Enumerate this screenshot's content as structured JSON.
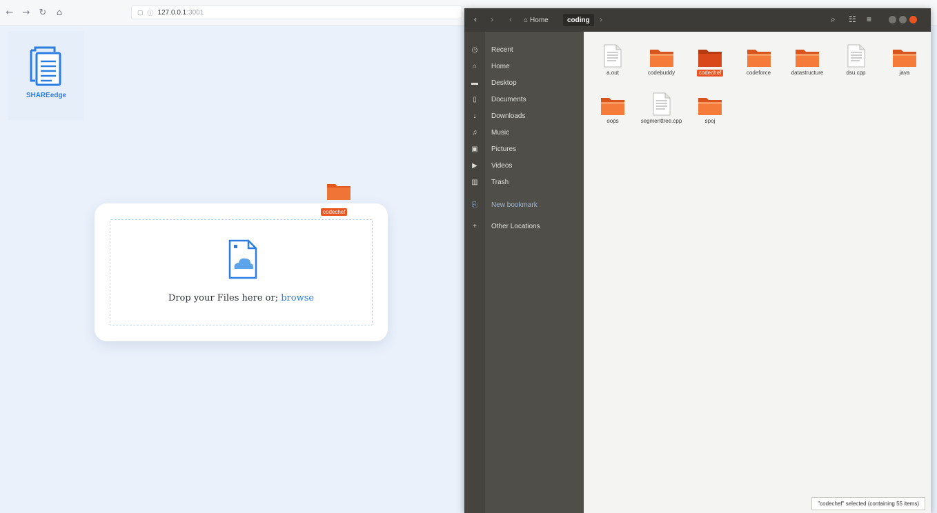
{
  "browser": {
    "url_host": "127.0.0.1",
    "url_port": ":3001",
    "back_glyph": "←",
    "forward_glyph": "→",
    "reload_glyph": "↻",
    "home_glyph": "⌂"
  },
  "app": {
    "logo_text": "SHAREedge",
    "drop_text_prefix": "Drop your Files here or; ",
    "browse_label": "browse",
    "drag_label": "codechef"
  },
  "file_manager": {
    "breadcrumb": [
      "Home",
      "coding"
    ],
    "sidebar": [
      {
        "label": "Recent",
        "icon": "clock-icon",
        "glyph": "◷"
      },
      {
        "label": "Home",
        "icon": "home-icon",
        "glyph": "⌂"
      },
      {
        "label": "Desktop",
        "icon": "desktop-icon",
        "glyph": "▬"
      },
      {
        "label": "Documents",
        "icon": "documents-icon",
        "glyph": "▯"
      },
      {
        "label": "Downloads",
        "icon": "download-icon",
        "glyph": "↓"
      },
      {
        "label": "Music",
        "icon": "music-icon",
        "glyph": "♫"
      },
      {
        "label": "Pictures",
        "icon": "pictures-icon",
        "glyph": "▣"
      },
      {
        "label": "Videos",
        "icon": "video-icon",
        "glyph": "▶"
      },
      {
        "label": "Trash",
        "icon": "trash-icon",
        "glyph": "▥"
      }
    ],
    "new_bookmark": "New bookmark",
    "other_locations": "Other Locations",
    "files": [
      {
        "name": "a.out",
        "type": "doc"
      },
      {
        "name": "codebuddy",
        "type": "folder"
      },
      {
        "name": "codechef",
        "type": "folder",
        "selected": true
      },
      {
        "name": "codeforce",
        "type": "folder"
      },
      {
        "name": "datastructure",
        "type": "folder"
      },
      {
        "name": "dsu.cpp",
        "type": "doc"
      },
      {
        "name": "java",
        "type": "folder"
      },
      {
        "name": "oops",
        "type": "folder"
      },
      {
        "name": "segmenttree.cpp",
        "type": "doc"
      },
      {
        "name": "spoj",
        "type": "folder"
      }
    ],
    "status": "\"codechef\" selected (containing 55 items)"
  },
  "colors": {
    "accent": "#2a7de1",
    "ubuntu_orange": "#e95420",
    "header_dark": "#3c3b37",
    "sidebar_dark": "#4f4e48"
  }
}
